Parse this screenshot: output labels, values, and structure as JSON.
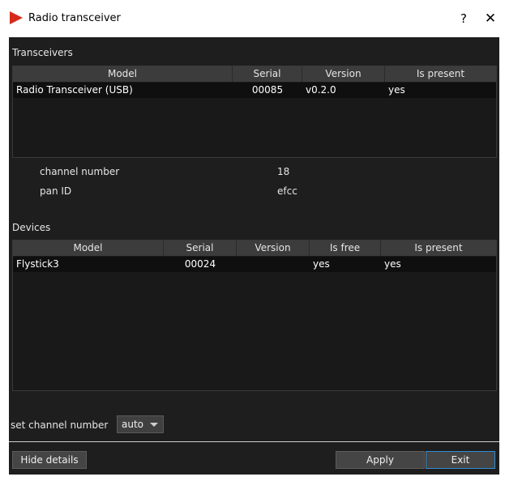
{
  "window": {
    "title": "Radio transceiver",
    "help_label": "?",
    "close_label": "✕",
    "icon": "red-play-triangle-icon",
    "accent_color": "#d62a1c"
  },
  "transceivers": {
    "section_label": "Transceivers",
    "columns": [
      "Model",
      "Serial",
      "Version",
      "Is present"
    ],
    "rows": [
      [
        "Radio Transceiver (USB)",
        "00085",
        "v0.2.0",
        "yes"
      ]
    ],
    "details": [
      {
        "label": "channel number",
        "value": "18"
      },
      {
        "label": "pan ID",
        "value": "efcc"
      }
    ]
  },
  "devices": {
    "section_label": "Devices",
    "columns": [
      "Model",
      "Serial",
      "Version",
      "Is free",
      "Is present"
    ],
    "rows": [
      [
        "Flystick3",
        "00024",
        "",
        "yes",
        "yes"
      ]
    ]
  },
  "footer": {
    "channel_label": "set channel number",
    "channel_value": "auto",
    "hide_details_label": "Hide details",
    "apply_label": "Apply",
    "exit_label": "Exit"
  }
}
